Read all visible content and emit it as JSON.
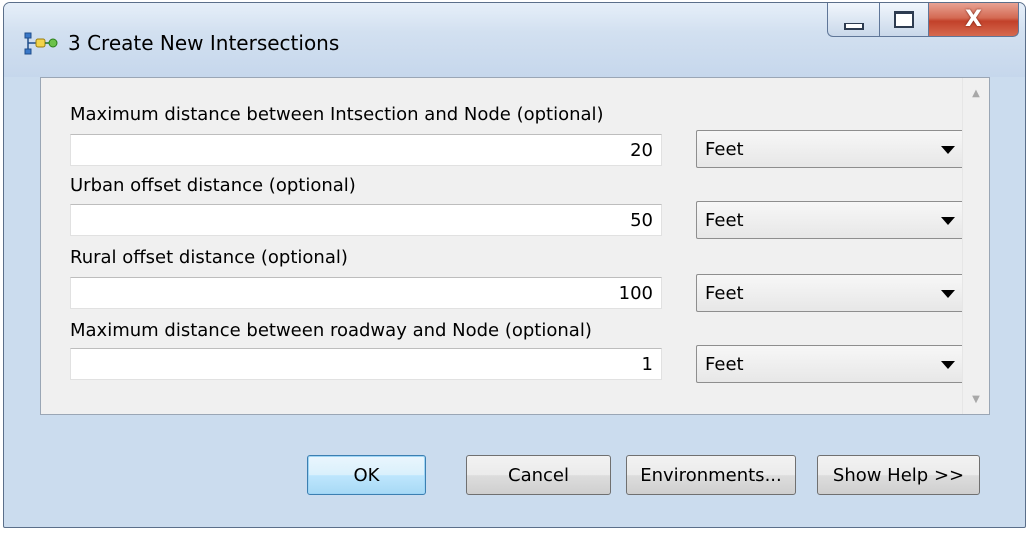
{
  "window": {
    "title": "3 Create New Intersections",
    "controls": {
      "minimize": "minimize",
      "maximize": "maximize",
      "close": "X"
    }
  },
  "parameters": [
    {
      "label": "Maximum distance between Intsection and Node (optional)",
      "value": "20",
      "unit": "Feet"
    },
    {
      "label": "Urban offset distance (optional)",
      "value": "50",
      "unit": "Feet"
    },
    {
      "label": "Rural offset distance (optional)",
      "value": "100",
      "unit": "Feet"
    },
    {
      "label": "Maximum distance between roadway and Node (optional)",
      "value": "1",
      "unit": "Feet"
    }
  ],
  "buttons": {
    "ok": "OK",
    "cancel": "Cancel",
    "environments": "Environments...",
    "help": "Show Help >>"
  },
  "icons": {
    "app": "model-tool-icon",
    "scroll_up": "scroll-up-arrow-icon",
    "scroll_down": "scroll-down-arrow-icon",
    "dropdown": "chevron-down-icon"
  },
  "colors": {
    "window_frame": "#cbdcee",
    "content_bg": "#f0f0f0",
    "close_button": "#c2412a",
    "default_button": "#3c7fb1"
  }
}
